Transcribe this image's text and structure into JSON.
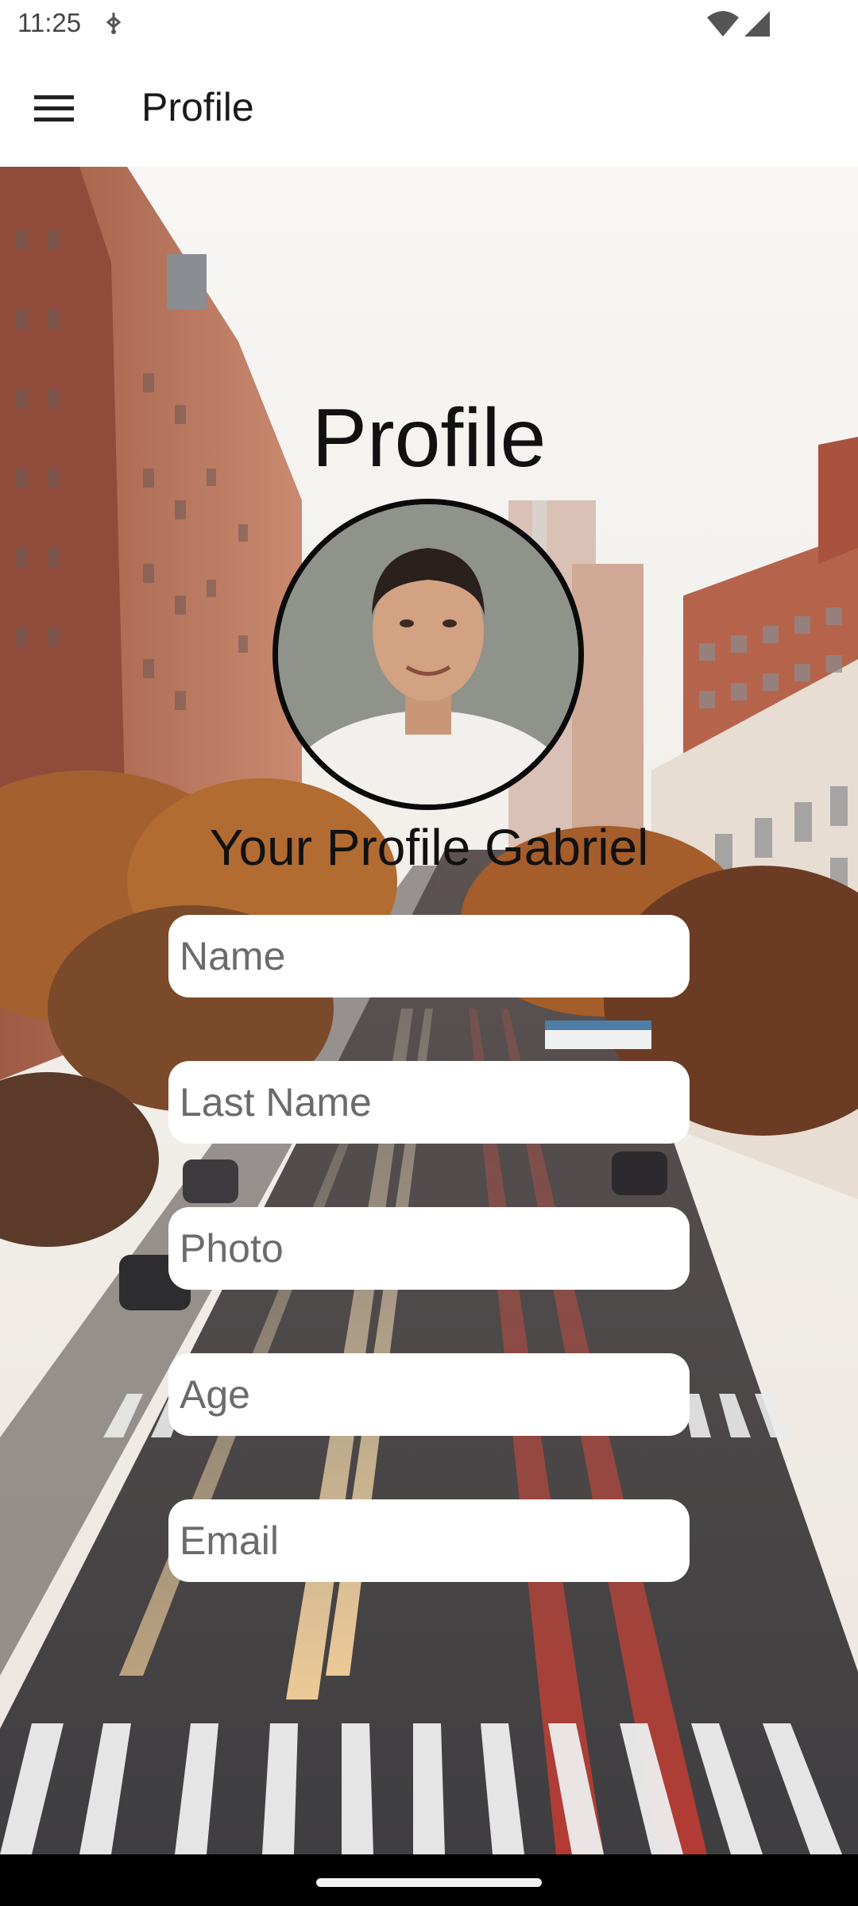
{
  "status_bar": {
    "time": "11:25"
  },
  "app_bar": {
    "title": "Profile",
    "menu_icon": "hamburger-menu-icon"
  },
  "main": {
    "heading": "Profile",
    "subtitle": "Your Profile Gabriel",
    "fields": [
      {
        "name": "name",
        "placeholder": "Name",
        "value": ""
      },
      {
        "name": "last_name",
        "placeholder": "Last Name",
        "value": ""
      },
      {
        "name": "photo",
        "placeholder": "Photo",
        "value": ""
      },
      {
        "name": "age",
        "placeholder": "Age",
        "value": ""
      },
      {
        "name": "email",
        "placeholder": "Email",
        "value": ""
      }
    ]
  },
  "colors": {
    "sky": "#f4f2ef",
    "buildings": "#b3694f",
    "trees": "#9b5a2c",
    "road": "#4b4a4b",
    "field_bg": "#ffffff",
    "text": "#111111"
  }
}
